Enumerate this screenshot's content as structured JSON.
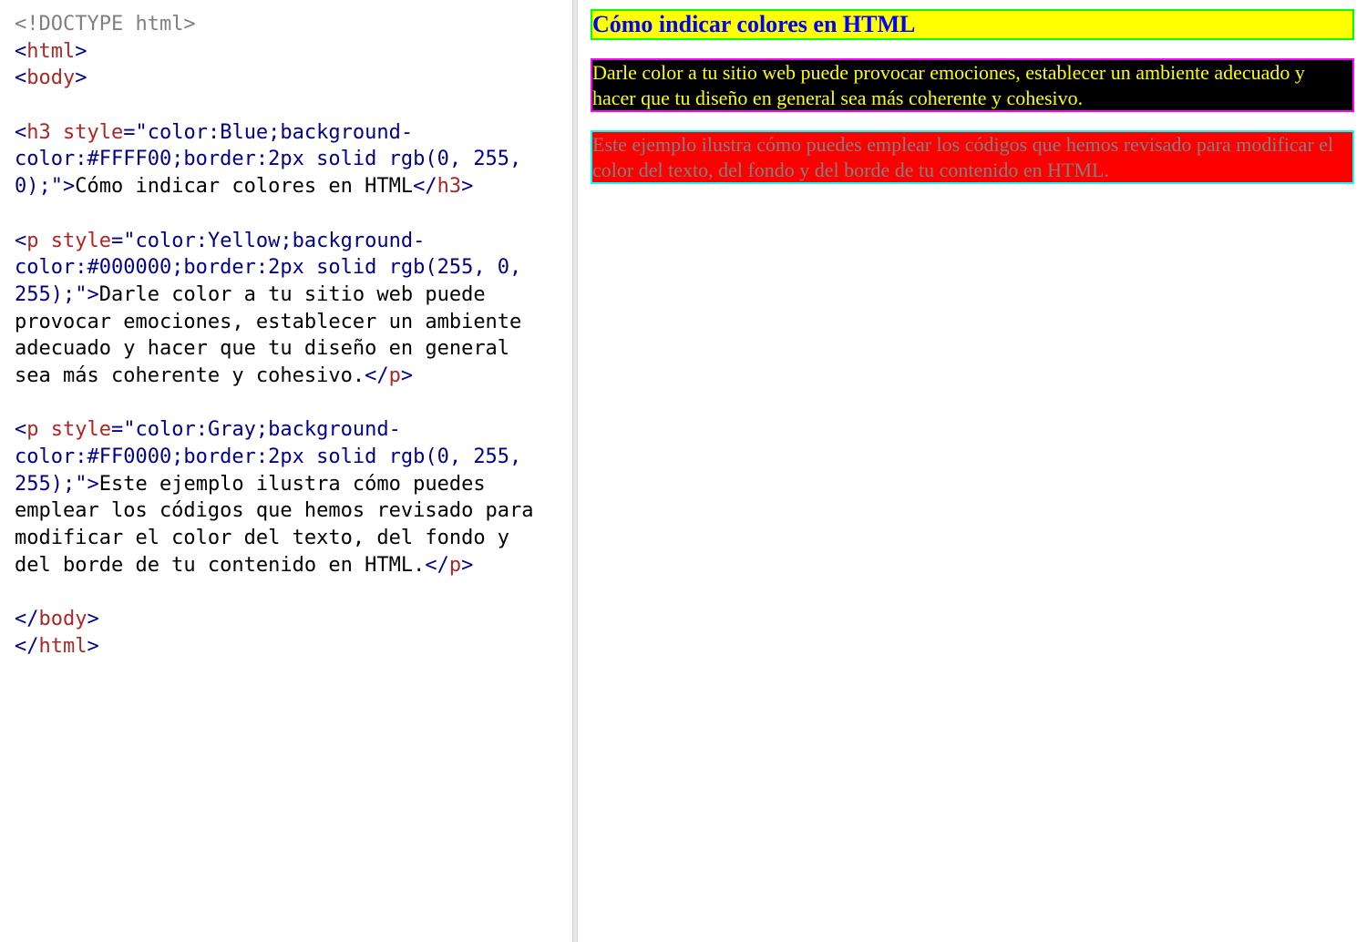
{
  "code": {
    "doctype": "<!DOCTYPE html>",
    "html_open": "html",
    "body_open": "body",
    "h3_tag": "h3",
    "p_tag": "p",
    "style_attr": "style",
    "h3_style": "\"color:Blue;background-color:#FFFF00;border:2px solid rgb(0, 255, 0);\"",
    "h3_text": "Cómo indicar colores en HTML",
    "p1_style": "\"color:Yellow;background-color:#000000;border:2px solid rgb(255, 0, 255);\"",
    "p1_text": "Darle color a tu sitio web puede provocar emociones, establecer un ambiente adecuado y hacer que tu diseño en general sea más coherente y cohesivo.",
    "p2_style": "\"color:Gray;background-color:#FF0000;border:2px solid rgb(0, 255, 255);\"",
    "p2_text": "Este ejemplo ilustra cómo puedes emplear los códigos que hemos revisado para modificar el color del texto, del fondo y del borde de tu contenido en HTML.",
    "body_close": "body",
    "html_close": "html"
  },
  "preview": {
    "h3": {
      "text": "Cómo indicar colores en HTML",
      "color": "blue",
      "background": "#FFFF00",
      "border": "2px solid rgb(0, 255, 0)"
    },
    "p1": {
      "text": "Darle color a tu sitio web puede provocar emociones, establecer un ambiente adecuado y hacer que tu diseño en general sea más coherente y cohesivo.",
      "color": "yellow",
      "background": "#000000",
      "border": "2px solid rgb(255, 0, 255)"
    },
    "p2": {
      "text": "Este ejemplo ilustra cómo puedes emplear los códigos que hemos revisado para modificar el color del texto, del fondo y del borde de tu contenido en HTML.",
      "color": "gray",
      "background": "#FF0000",
      "border": "2px solid rgb(0, 255, 255)"
    }
  }
}
